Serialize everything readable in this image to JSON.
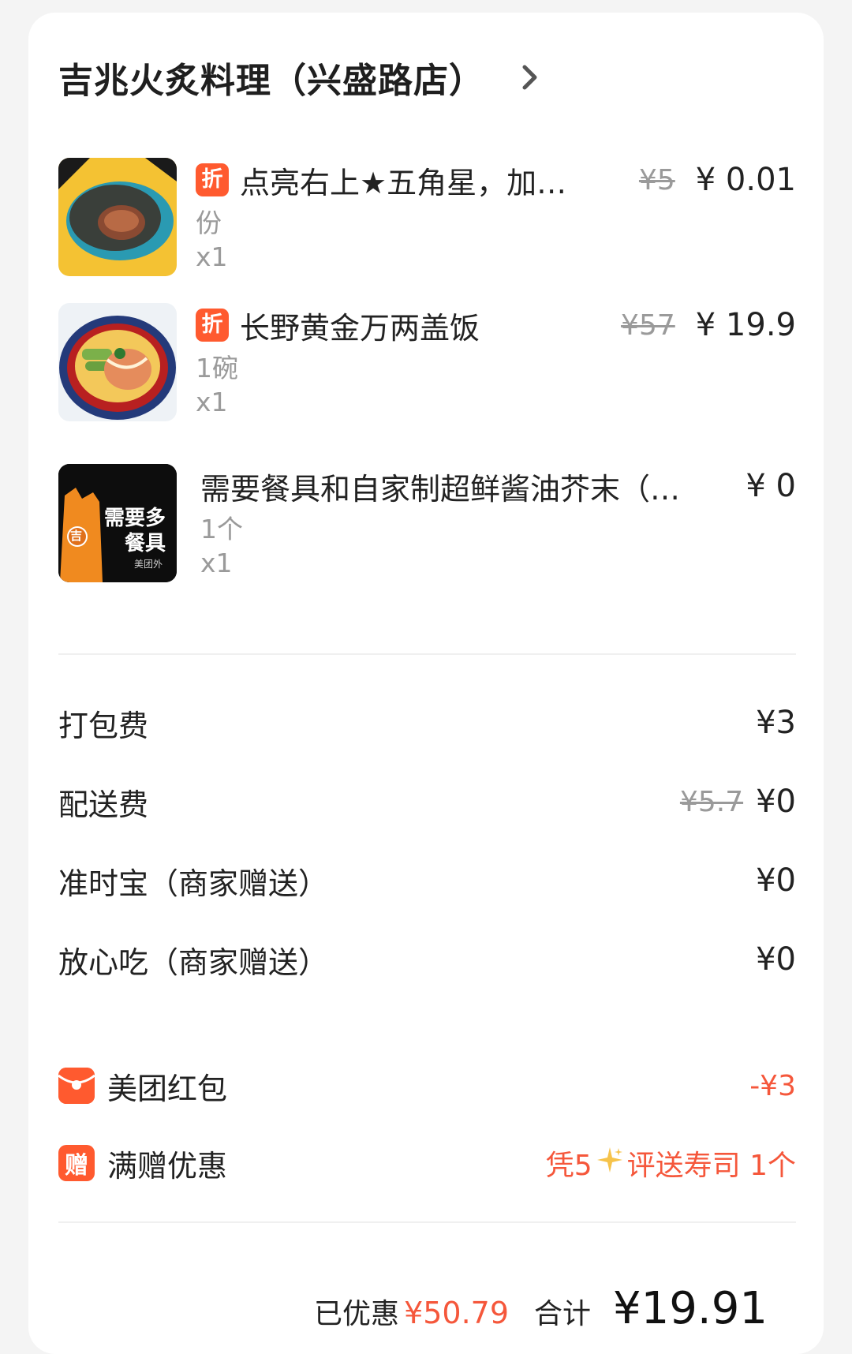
{
  "shop": {
    "name": "吉兆火炙料理（兴盛路店）"
  },
  "items": [
    {
      "tag": "折",
      "name": "点亮右上★五角星，加…",
      "original_price": "¥5",
      "price": "¥ 0.01",
      "spec": "份",
      "qty": "x1"
    },
    {
      "tag": "折",
      "name": "长野黄金万两盖饭",
      "original_price": "¥57",
      "price": "¥ 19.9",
      "spec": "1碗",
      "qty": "x1"
    },
    {
      "name": "需要餐具和自家制超鲜酱油芥末（…",
      "price": "¥ 0",
      "spec": "1个",
      "qty": "x1",
      "thumb_text_1": "需要多",
      "thumb_text_2": "餐具",
      "thumb_badge": "吉",
      "thumb_brand": "美团外"
    }
  ],
  "fees": [
    {
      "label": "打包费",
      "value": "¥3"
    },
    {
      "label": "配送费",
      "original": "¥5.7",
      "value": "¥0"
    },
    {
      "label": "准时宝（商家赠送）",
      "value": "¥0"
    },
    {
      "label": "放心吃（商家赠送）",
      "value": "¥0"
    }
  ],
  "promos": [
    {
      "icon": "red-envelope-icon",
      "label": "美团红包",
      "value": "-¥3"
    },
    {
      "icon_text": "赠",
      "label": "满赠优惠",
      "value_prefix": "凭5",
      "value_suffix": "评送寿司 1个"
    }
  ],
  "summary": {
    "saved_label": "已优惠",
    "saved_value": "¥50.79",
    "total_label": "合计",
    "total_value": "¥19.91"
  },
  "colors": {
    "accent": "#ff5a2f",
    "discount_text": "#f5573b",
    "muted": "#9a9a9a"
  }
}
